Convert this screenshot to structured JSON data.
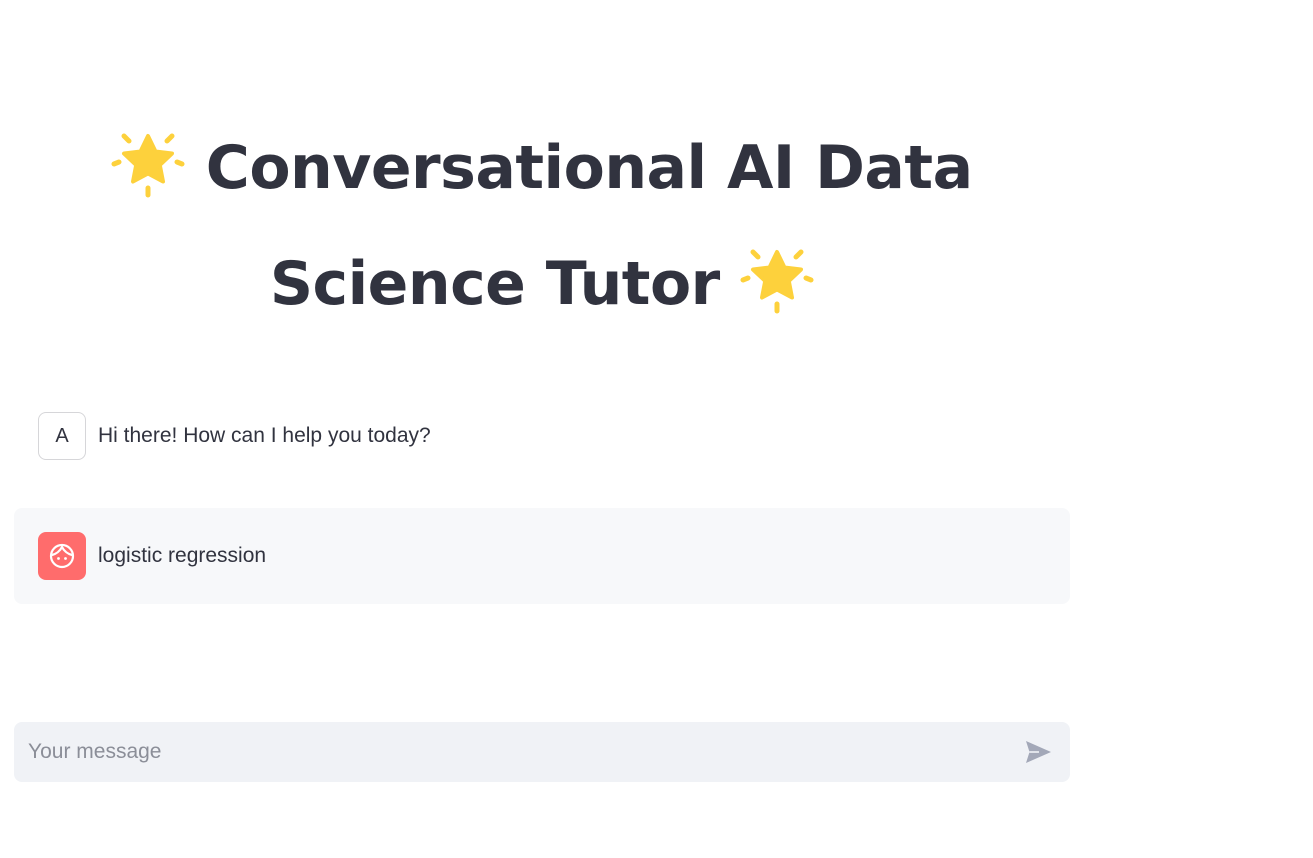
{
  "header": {
    "title_line1": "Conversational AI Data",
    "title_line2": "Science Tutor",
    "title_icon": "glowing-star-icon"
  },
  "chat": {
    "messages": [
      {
        "role": "assistant",
        "avatar_letter": "A",
        "text": "Hi there! How can I help you today?"
      },
      {
        "role": "user",
        "avatar_icon": "face-icon",
        "text": "logistic regression"
      }
    ]
  },
  "input": {
    "placeholder": "Your message",
    "value": "",
    "send_icon": "send-icon"
  },
  "colors": {
    "text": "#31333f",
    "user_avatar": "#ff6c6c",
    "user_message_bg": "#f7f8fa",
    "input_bg": "#f0f2f6",
    "star": "#fdd13c"
  }
}
